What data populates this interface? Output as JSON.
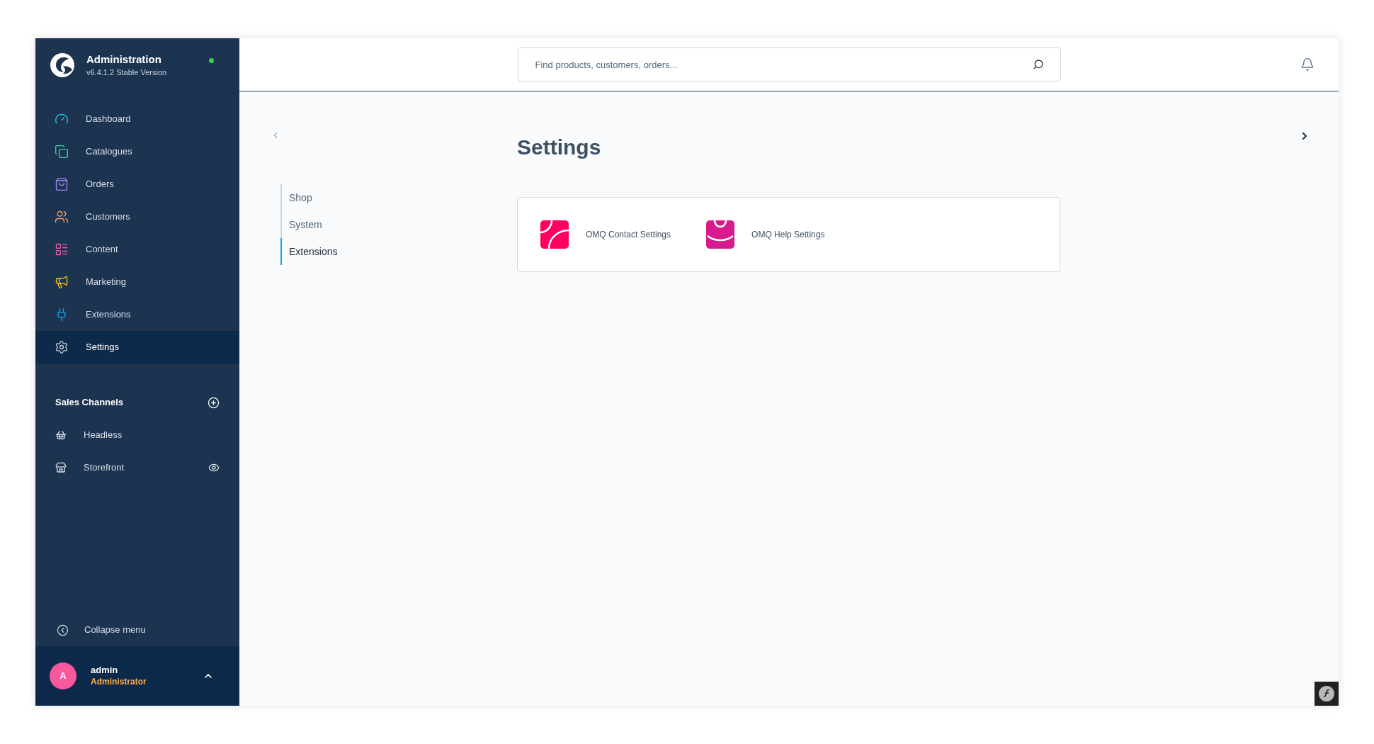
{
  "brand": {
    "title": "Administration",
    "version": "v6.4.1.2 Stable Version",
    "online": true
  },
  "nav": [
    {
      "label": "Dashboard",
      "selected": false
    },
    {
      "label": "Catalogues",
      "selected": false
    },
    {
      "label": "Orders",
      "selected": false
    },
    {
      "label": "Customers",
      "selected": false
    },
    {
      "label": "Content",
      "selected": false
    },
    {
      "label": "Marketing",
      "selected": false
    },
    {
      "label": "Extensions",
      "selected": false
    },
    {
      "label": "Settings",
      "selected": true
    }
  ],
  "sales_channels": {
    "title": "Sales Channels",
    "items": [
      {
        "label": "Headless",
        "kind": "headless"
      },
      {
        "label": "Storefront",
        "kind": "storefront"
      }
    ]
  },
  "collapse_label": "Collapse menu",
  "user": {
    "initial": "A",
    "name": "admin",
    "role": "Administrator"
  },
  "search": {
    "placeholder": "Find products, customers, orders..."
  },
  "page": {
    "title": "Settings",
    "tabs": [
      {
        "label": "Shop",
        "selected": false
      },
      {
        "label": "System",
        "selected": false
      },
      {
        "label": "Extensions",
        "selected": true
      }
    ],
    "cards": [
      {
        "label": "OMQ Contact Settings",
        "kind": "contact"
      },
      {
        "label": "OMQ Help Settings",
        "kind": "help"
      }
    ]
  }
}
